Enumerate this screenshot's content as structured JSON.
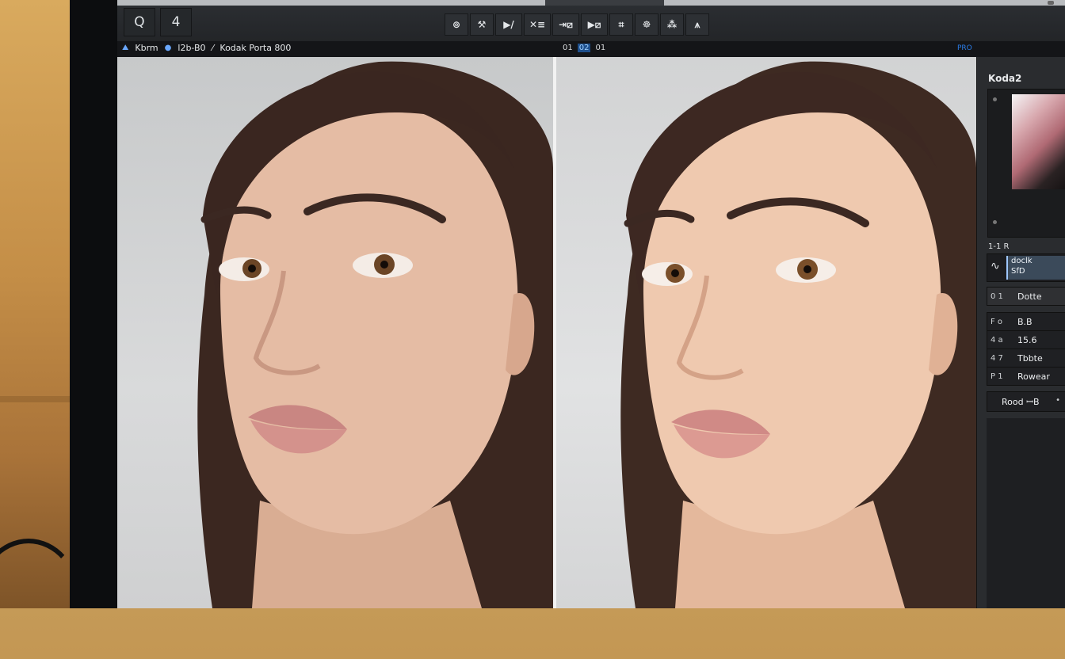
{
  "window": {
    "left_tools": [
      {
        "icon": "search-icon",
        "glyph": "Q"
      },
      {
        "icon": "zoom-fit-icon",
        "glyph": "4"
      }
    ],
    "center_tools": [
      {
        "icon": "loupe-icon",
        "glyph": "⊚"
      },
      {
        "icon": "brush-icon",
        "glyph": "⚒"
      },
      {
        "icon": "play-edit-icon",
        "glyph": "▶/"
      },
      {
        "icon": "cross-compare-icon",
        "glyph": "✕≡"
      },
      {
        "icon": "before-after-icon",
        "glyph": "⇥⧄"
      },
      {
        "icon": "split-view-icon",
        "glyph": "▶⧄"
      },
      {
        "icon": "crop-icon",
        "glyph": "⌗"
      },
      {
        "icon": "people-icon",
        "glyph": "☸"
      },
      {
        "icon": "mask-icon",
        "glyph": "⁂"
      },
      {
        "icon": "pin-icon",
        "glyph": "⩚"
      }
    ]
  },
  "infobar": {
    "file_name": "Kbrm",
    "file_size": "l2b-B0",
    "preset": "Kodak Porta 800",
    "frames": [
      "01",
      "02",
      "01"
    ],
    "active_frame_index": 1,
    "flag": "PRO"
  },
  "panel": {
    "title": "Koda2",
    "section": "1-1 R",
    "curve": {
      "line1": "doclk",
      "line2": "SfD"
    },
    "properties": [
      {
        "key": "0 1",
        "value": "Dotte"
      },
      {
        "key": "F o",
        "value": "B.B"
      },
      {
        "key": "4 a",
        "value": "15.6"
      },
      {
        "key": "4 7",
        "value": "Tbbte"
      },
      {
        "key": "P 1",
        "value": "Rowear"
      }
    ],
    "preset_button": "Rood ꟷB",
    "preset_arrow": "•"
  },
  "colors": {
    "accent": "#2b7de9",
    "panel_bg": "#2a2c2f",
    "toolbar_bg": "#232528",
    "wall": "#c59a57"
  },
  "canvas": {
    "views": [
      "before-photo",
      "after-photo"
    ]
  }
}
